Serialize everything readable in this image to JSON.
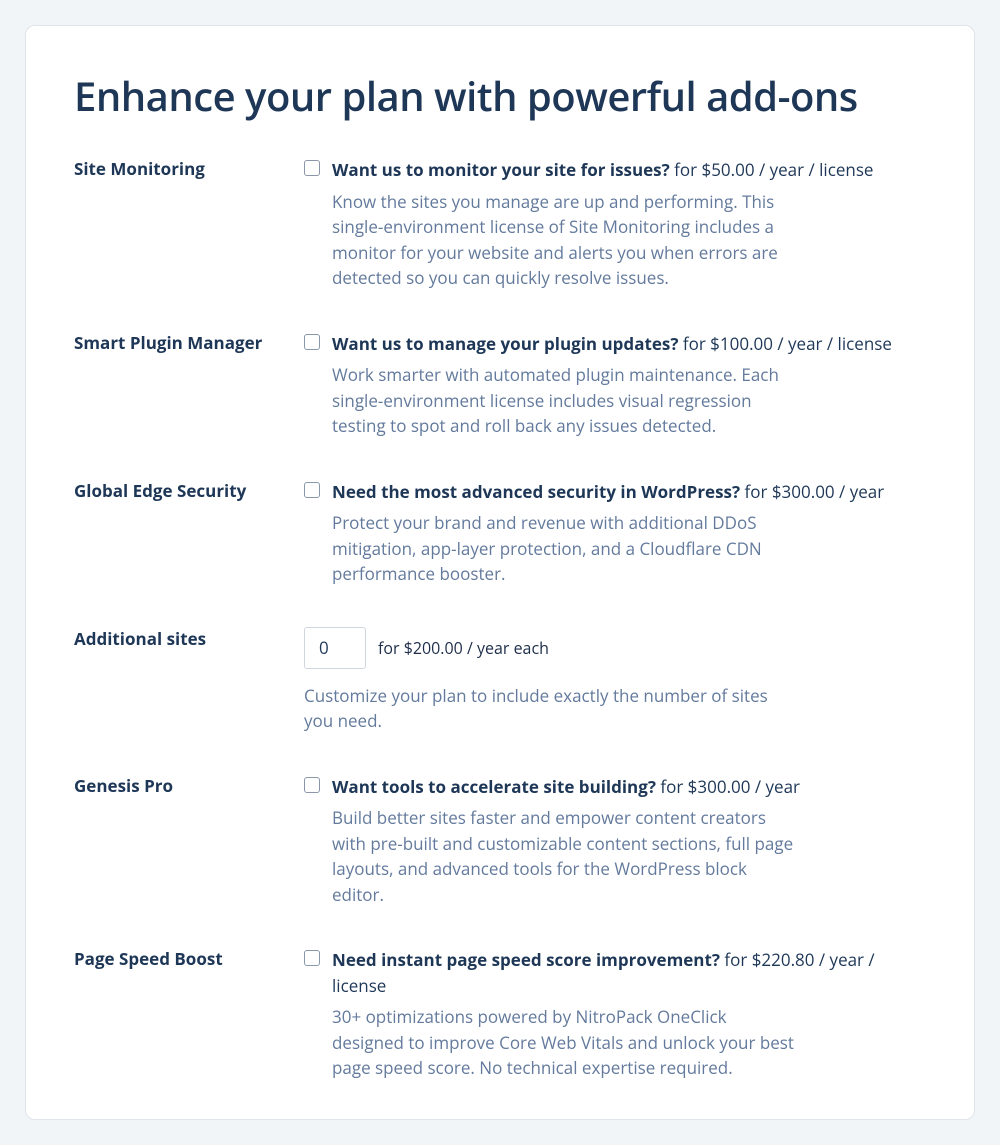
{
  "title": "Enhance your plan with powerful add-ons",
  "addons": {
    "siteMonitoring": {
      "name": "Site Monitoring",
      "question": "Want us to monitor your site for issues?",
      "price": "for $50.00 / year / license",
      "description": "Know the sites you manage are up and performing. This single-environment license of Site Monitoring includes a monitor for your website and alerts you when errors are detected so you can quickly resolve issues."
    },
    "smartPluginManager": {
      "name": "Smart Plugin Manager",
      "question": "Want us to manage your plugin updates?",
      "price": "for $100.00 / year / license",
      "description": "Work smarter with automated plugin maintenance. Each single-environment license includes visual regression testing to spot and roll back any issues detected."
    },
    "globalEdgeSecurity": {
      "name": "Global Edge Security",
      "question": "Need the most advanced security in WordPress?",
      "price": "for $300.00 / year",
      "description": "Protect your brand and revenue with additional DDoS mitigation, app-layer protection, and a Cloudflare CDN performance booster."
    },
    "additionalSites": {
      "name": "Additional sites",
      "value": "0",
      "price": "for $200.00 / year each",
      "description": "Customize your plan to include exactly the number of sites you need."
    },
    "genesisPro": {
      "name": "Genesis Pro",
      "question": "Want tools to accelerate site building?",
      "price": "for $300.00 / year",
      "description": "Build better sites faster and empower content creators with pre-built and customizable content sections, full page layouts, and advanced tools for the WordPress block editor."
    },
    "pageSpeedBoost": {
      "name": "Page Speed Boost",
      "question": "Need instant page speed score improvement?",
      "price": "for $220.80 / year / license",
      "description": "30+ optimizations powered by NitroPack OneClick designed to improve Core Web Vitals and unlock your best page speed score. No technical expertise required."
    }
  }
}
